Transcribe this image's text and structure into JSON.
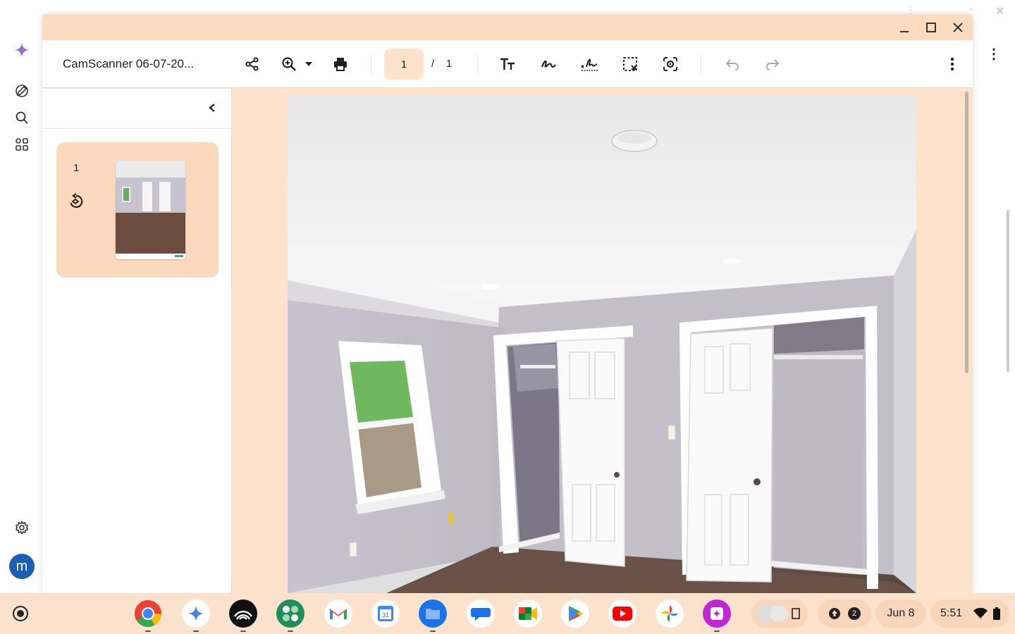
{
  "window": {
    "doc_title": "CamScanner 06-07-20...",
    "page_current": "1",
    "page_separator": "/",
    "page_total": "1"
  },
  "sidebar": {
    "thumbnail_number": "1"
  },
  "shelf": {
    "date": "Jun 8",
    "time": "5:51",
    "notification_count": "2",
    "avatar_letter": "m"
  },
  "colors": {
    "accent": "#fde3cc",
    "titlebar": "#fcdcbf",
    "thumb_card": "#fcd8bd"
  }
}
